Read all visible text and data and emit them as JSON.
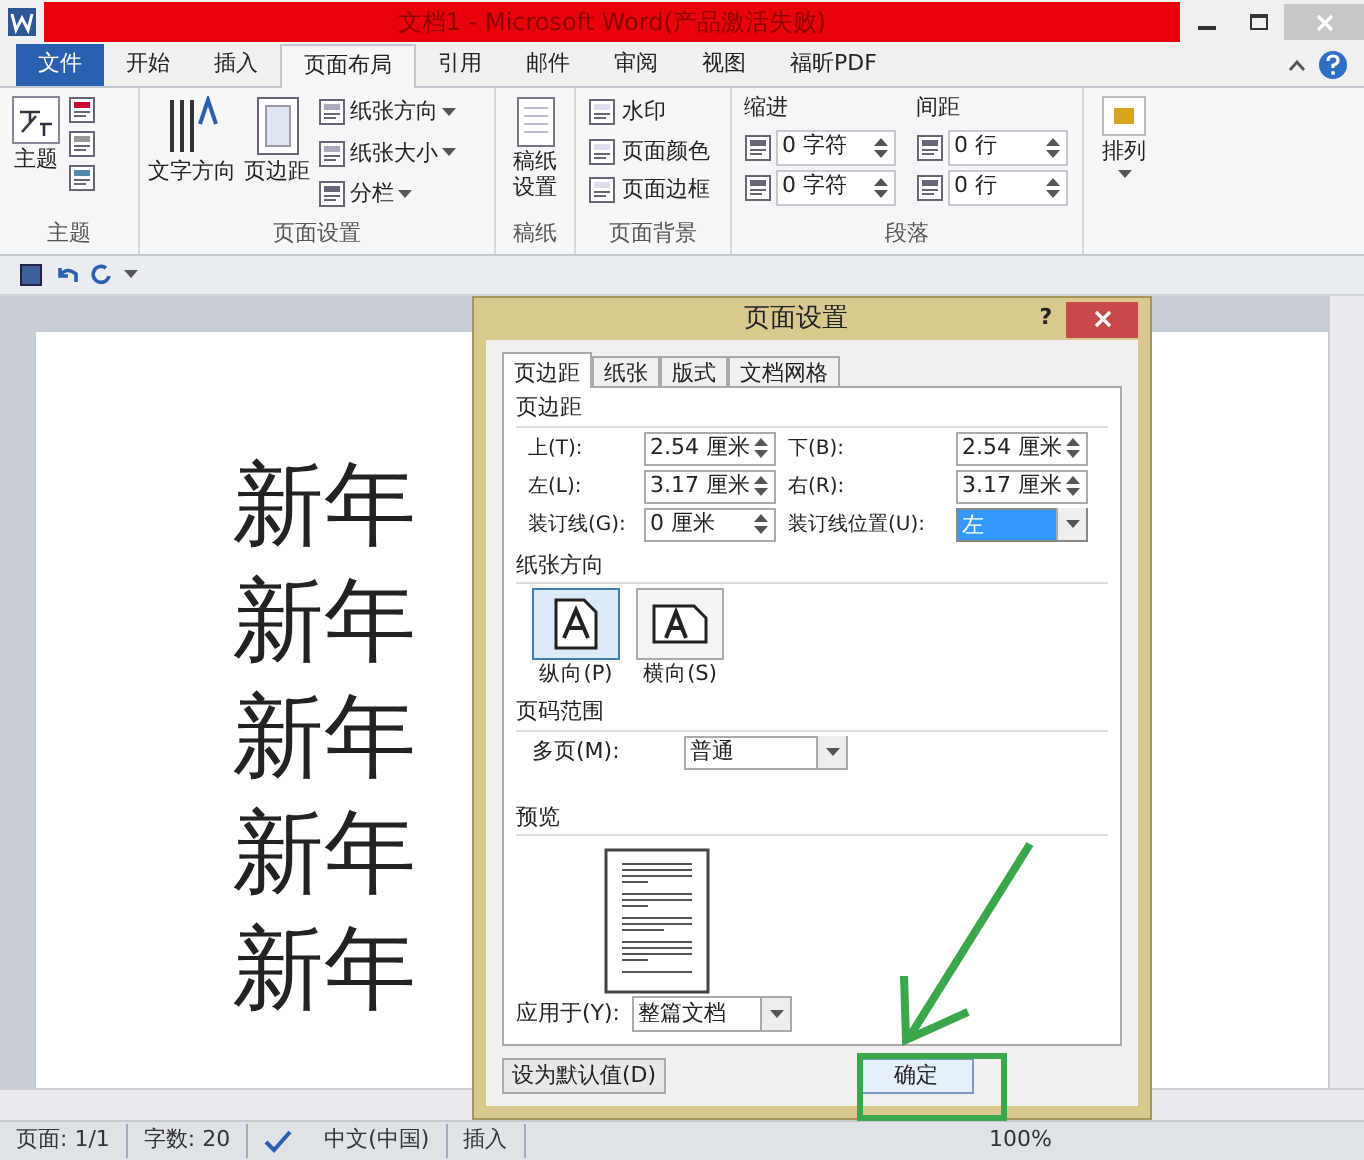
{
  "window": {
    "title": "文档1 - Microsoft Word(产品激活失败)"
  },
  "ribbon_tabs": [
    {
      "label": "文件",
      "kind": "file",
      "selected": false
    },
    {
      "label": "开始",
      "kind": "tab",
      "selected": false
    },
    {
      "label": "插入",
      "kind": "tab",
      "selected": false
    },
    {
      "label": "页面布局",
      "kind": "tab",
      "selected": true
    },
    {
      "label": "引用",
      "kind": "tab",
      "selected": false
    },
    {
      "label": "邮件",
      "kind": "tab",
      "selected": false
    },
    {
      "label": "审阅",
      "kind": "tab",
      "selected": false
    },
    {
      "label": "视图",
      "kind": "tab",
      "selected": false
    },
    {
      "label": "福昕PDF",
      "kind": "tab",
      "selected": false
    }
  ],
  "ribbon": {
    "theme": {
      "label": "主题",
      "button": "主题"
    },
    "page_setup": {
      "label": "页面设置",
      "text_direction": "文字方向",
      "margins": "页边距",
      "orientation": "纸张方向",
      "size": "纸张大小",
      "columns": "分栏"
    },
    "manuscript": {
      "label": "稿纸",
      "button": "稿纸设置"
    },
    "background": {
      "label": "页面背景",
      "items": [
        "水印",
        "页面颜色",
        "页面边框"
      ]
    },
    "paragraph": {
      "label": "段落",
      "indent": "缩进",
      "spacing": "间距",
      "indent_fields": [
        "0 字符",
        "0 字符"
      ],
      "spacing_fields": [
        "0 行",
        "0 行"
      ]
    },
    "arrange": {
      "button": "排列"
    }
  },
  "document": {
    "lines": [
      "新年",
      "新年",
      "新年",
      "新年",
      "新年"
    ]
  },
  "dialog": {
    "title": "页面设置",
    "help": "?",
    "tabs": [
      {
        "label": "页边距",
        "selected": true
      },
      {
        "label": "纸张",
        "selected": false
      },
      {
        "label": "版式",
        "selected": false
      },
      {
        "label": "文档网格",
        "selected": false
      }
    ],
    "margins_heading": "页边距",
    "margins": [
      {
        "label": "上(T):",
        "value": "2.54 厘米",
        "kind": "spin"
      },
      {
        "label": "下(B):",
        "value": "2.54 厘米",
        "kind": "spin"
      },
      {
        "label": "左(L):",
        "value": "3.17 厘米",
        "kind": "spin"
      },
      {
        "label": "右(R):",
        "value": "3.17 厘米",
        "kind": "spin"
      },
      {
        "label": "装订线(G):",
        "value": "0 厘米",
        "kind": "spin"
      },
      {
        "label": "装订线位置(U):",
        "value": "左",
        "kind": "select",
        "focused": true
      }
    ],
    "orientation_heading": "纸张方向",
    "orientations": [
      {
        "label": "纵向(P)",
        "kind": "portrait",
        "selected": true
      },
      {
        "label": "横向(S)",
        "kind": "landscape",
        "selected": false
      }
    ],
    "pages_heading": "页码范围",
    "multiple_pages": {
      "label": "多页(M):",
      "value": "普通"
    },
    "preview_heading": "预览",
    "apply_to": {
      "label": "应用于(Y):",
      "value": "整篇文档"
    },
    "default_button": "设为默认值(D)",
    "ok_button": "确定"
  },
  "status_bar": {
    "page": "页面: 1/1",
    "words": "字数: 20",
    "language": "中文(中国)",
    "mode": "插入",
    "zoom": "100%"
  }
}
